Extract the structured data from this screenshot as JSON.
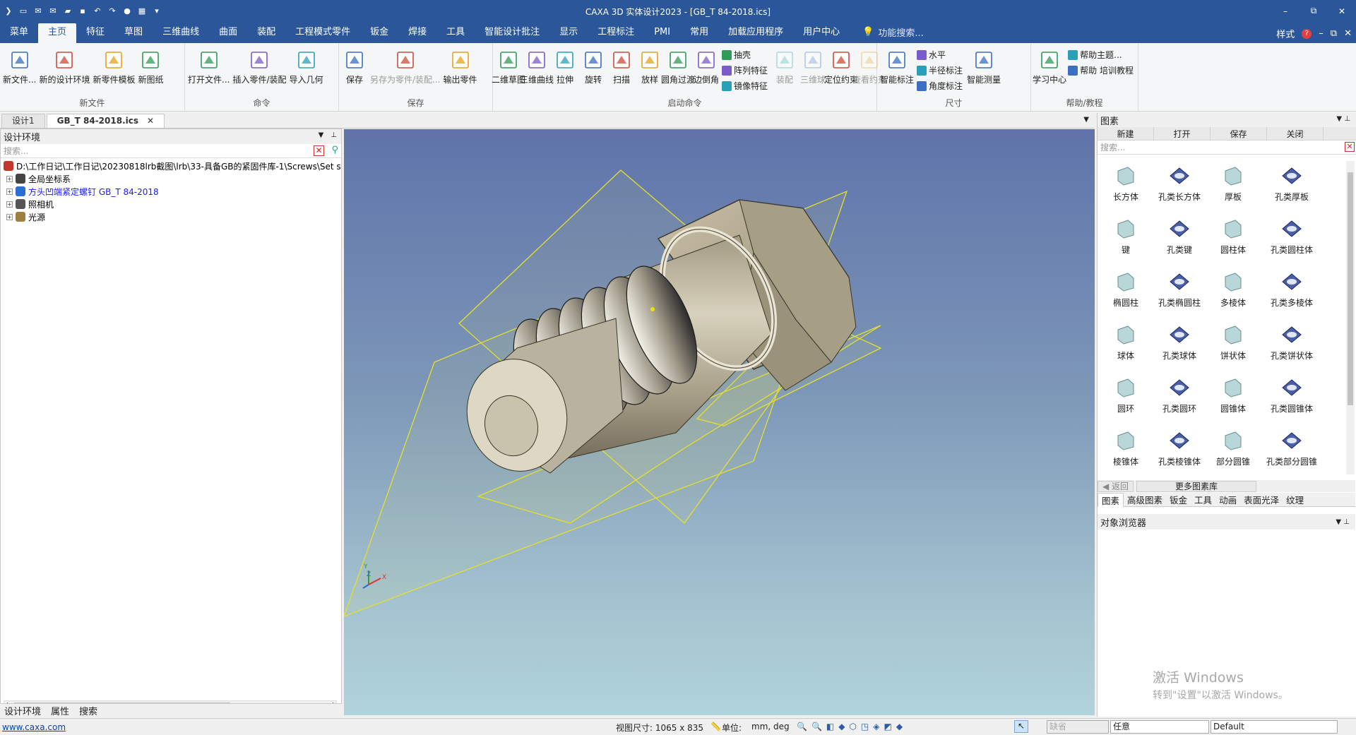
{
  "app": {
    "title": "CAXA 3D 实体设计2023 - [GB_T 84-2018.ics]"
  },
  "quick_access": [
    "logo-icon",
    "new-icon",
    "mail-icon",
    "mail-icon",
    "open-folder-icon",
    "save-icon",
    "undo-icon",
    "redo-icon",
    "record-icon",
    "grid-icon",
    "dropdown-icon"
  ],
  "window_controls": [
    "–",
    "⧉",
    "✕"
  ],
  "menu": {
    "tabs": [
      "菜单",
      "主页",
      "特征",
      "草图",
      "三维曲线",
      "曲面",
      "装配",
      "工程模式零件",
      "钣金",
      "焊接",
      "工具",
      "智能设计批注",
      "显示",
      "工程标注",
      "PMI",
      "常用",
      "加载应用程序",
      "用户中心"
    ],
    "active": "主页",
    "search": "功能搜索...",
    "style": "样式",
    "help": "?"
  },
  "ribbon": {
    "groups": [
      {
        "label": "新文件",
        "buttons": [
          "新文件...",
          "新的设计环境",
          "新零件模板",
          "新图纸"
        ]
      },
      {
        "label": "命令",
        "buttons": [
          "打开文件...",
          "插入零件/装配",
          "导入几何"
        ]
      },
      {
        "label": "保存",
        "buttons": [
          "保存",
          "另存为零件/装配...",
          "输出零件"
        ]
      },
      {
        "label": "启动命令",
        "buttons": [
          "二维草图",
          "三维曲线",
          "拉伸",
          "旋转",
          "扫描",
          "放样",
          "圆角过渡",
          "边倒角"
        ],
        "small": [
          "抽壳",
          "阵列特征",
          "镜像特征"
        ],
        "after": [
          "装配",
          "三维球",
          "定位约束",
          "查看约束"
        ]
      },
      {
        "label": "尺寸",
        "buttons": [
          "智能标注"
        ],
        "small": [
          "水平",
          "半径标注",
          "角度标注"
        ],
        "after": [
          "智能测量"
        ]
      },
      {
        "label": "帮助/教程",
        "buttons": [
          "学习中心"
        ],
        "small": [
          "帮助主题...",
          "帮助 培训教程"
        ]
      }
    ]
  },
  "doc_tabs": [
    "设计1",
    "GB_T 84-2018.ics"
  ],
  "left_panel": {
    "title": "设计环境",
    "search_placeholder": "搜索...",
    "tree": [
      {
        "label": "D:\\工作日记\\工作日记\\20230818lrb截图\\lrb\\33-具备GB的紧固件库-1\\Screws\\Set s",
        "color": "#000000"
      },
      {
        "label": "全局坐标系",
        "color": "#000000"
      },
      {
        "label": "方头凹端紧定螺钉 GB_T 84-2018",
        "color": "#1a1aff"
      },
      {
        "label": "照相机",
        "color": "#000000"
      },
      {
        "label": "光源",
        "color": "#000000"
      }
    ],
    "bottom_tabs": [
      "设计环境",
      "属性",
      "搜索"
    ]
  },
  "right_panel": {
    "title": "图素",
    "buttons": [
      "新建",
      "打开",
      "保存",
      "关闭"
    ],
    "search_placeholder": "搜索...",
    "items": [
      "长方体",
      "孔类长方体",
      "厚板",
      "孔类厚板",
      "键",
      "孔类键",
      "圆柱体",
      "孔类圆柱体",
      "椭圆柱",
      "孔类椭圆柱",
      "多棱体",
      "孔类多棱体",
      "球体",
      "孔类球体",
      "饼状体",
      "孔类饼状体",
      "圆环",
      "孔类圆环",
      "圆锥体",
      "孔类圆锥体",
      "棱锥体",
      "孔类棱锥体",
      "部分圆锥",
      "孔类部分圆锥"
    ],
    "nav": [
      "返回",
      "更多图素库"
    ],
    "categories": [
      "图素",
      "高级图素",
      "钣金",
      "工具",
      "动画",
      "表面光泽",
      "纹理"
    ],
    "object_browser": "对象浏览器"
  },
  "watermark": {
    "line1": "激活 Windows",
    "line2": "转到\"设置\"以激活 Windows。"
  },
  "status": {
    "link": "www.caxa.com",
    "view_size": "视图尺寸: 1065 x  835",
    "unit_label": "单位:",
    "unit_value": "mm, deg",
    "combo1": "缺省",
    "combo2": "任意",
    "combo3": "Default"
  },
  "colors": {
    "title_bar": "#2b579a",
    "viewport_top": "#5f73aa",
    "viewport_bottom": "#b0d3dc"
  }
}
